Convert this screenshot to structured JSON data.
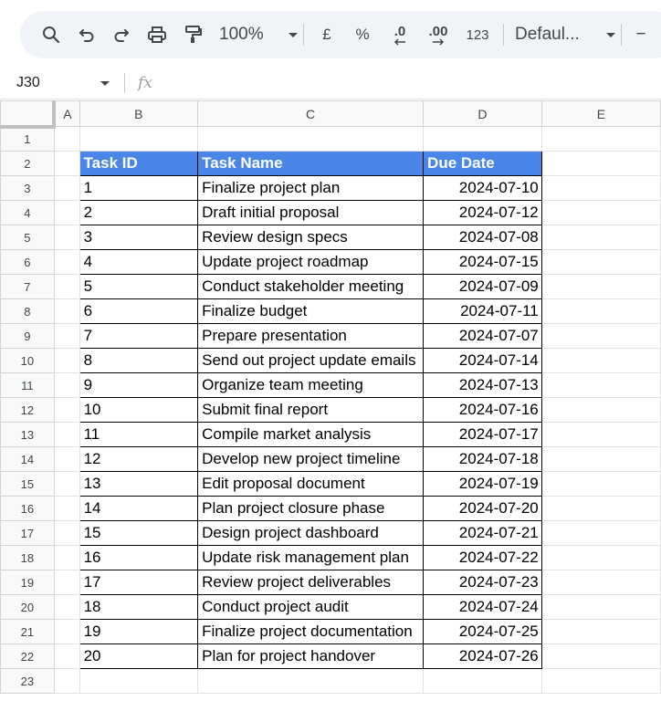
{
  "toolbar": {
    "zoom": "100%",
    "currency": "£",
    "percent": "%",
    "decrease_decimal": ".0",
    "increase_decimal": ".00",
    "number_format": "123",
    "font": "Defaul...",
    "font_size_minus": "−"
  },
  "formula_bar": {
    "cell_ref": "J30",
    "fx": "fx"
  },
  "columns": [
    "A",
    "B",
    "C",
    "D",
    "E"
  ],
  "row_numbers": [
    "1",
    "2",
    "3",
    "4",
    "5",
    "6",
    "7",
    "8",
    "9",
    "10",
    "11",
    "12",
    "13",
    "14",
    "15",
    "16",
    "17",
    "18",
    "19",
    "20",
    "21",
    "22",
    "23"
  ],
  "table": {
    "headers": [
      "Task ID",
      "Task Name",
      "Due Date"
    ],
    "rows": [
      [
        "1",
        "Finalize project plan",
        "2024-07-10"
      ],
      [
        "2",
        "Draft initial proposal",
        "2024-07-12"
      ],
      [
        "3",
        "Review design specs",
        "2024-07-08"
      ],
      [
        "4",
        "Update project roadmap",
        "2024-07-15"
      ],
      [
        "5",
        "Conduct stakeholder meeting",
        "2024-07-09"
      ],
      [
        "6",
        "Finalize budget",
        "2024-07-11"
      ],
      [
        "7",
        "Prepare presentation",
        "2024-07-07"
      ],
      [
        "8",
        "Send out project update emails",
        "2024-07-14"
      ],
      [
        "9",
        "Organize team meeting",
        "2024-07-13"
      ],
      [
        "10",
        "Submit final report",
        "2024-07-16"
      ],
      [
        "11",
        "Compile market analysis",
        "2024-07-17"
      ],
      [
        "12",
        "Develop new project timeline",
        "2024-07-18"
      ],
      [
        "13",
        "Edit proposal document",
        "2024-07-19"
      ],
      [
        "14",
        "Plan project closure phase",
        "2024-07-20"
      ],
      [
        "15",
        "Design project dashboard",
        "2024-07-21"
      ],
      [
        "16",
        "Update risk management plan",
        "2024-07-22"
      ],
      [
        "17",
        "Review project deliverables",
        "2024-07-23"
      ],
      [
        "18",
        "Conduct project audit",
        "2024-07-24"
      ],
      [
        "19",
        "Finalize project documentation",
        "2024-07-25"
      ],
      [
        "20",
        "Plan for project handover",
        "2024-07-26"
      ]
    ]
  },
  "colors": {
    "header_fill": "#4a86e8",
    "toolbar_bg": "#f0f4f9"
  }
}
